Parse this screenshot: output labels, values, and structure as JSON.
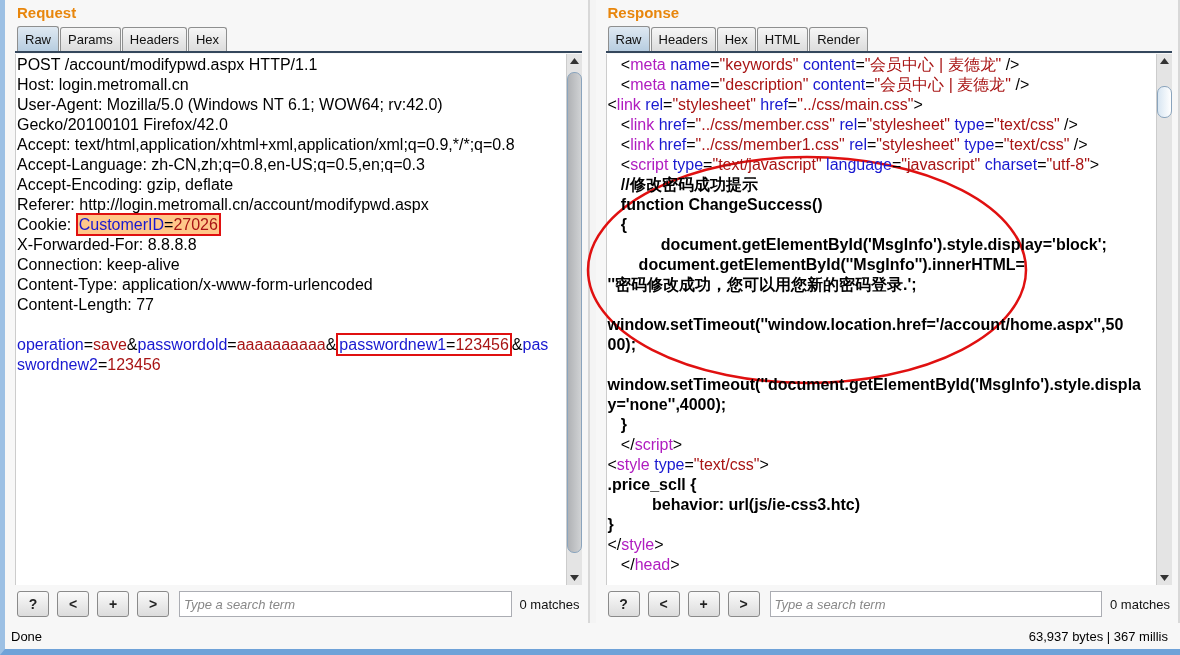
{
  "request": {
    "title": "Request",
    "tabs": [
      {
        "label": "Raw",
        "selected": true
      },
      {
        "label": "Params",
        "selected": false
      },
      {
        "label": "Headers",
        "selected": false
      },
      {
        "label": "Hex",
        "selected": false
      }
    ],
    "lines": [
      {
        "kind": "code",
        "segments": [
          {
            "kind": "text",
            "text": "POST /account/modifypwd.aspx HTTP/1.1"
          }
        ]
      },
      {
        "kind": "code",
        "segments": [
          {
            "kind": "text",
            "text": "Host: login.metromall.cn"
          }
        ]
      },
      {
        "kind": "code",
        "segments": [
          {
            "kind": "text",
            "text": "User-Agent: Mozilla/5.0 (Windows NT 6.1; WOW64; rv:42.0)"
          }
        ]
      },
      {
        "kind": "code",
        "segments": [
          {
            "kind": "text",
            "text": "Gecko/20100101 Firefox/42.0"
          }
        ]
      },
      {
        "kind": "code",
        "segments": [
          {
            "kind": "text",
            "text": "Accept: text/html,application/xhtml+xml,application/xml;q=0.9,*/*;q=0.8"
          }
        ]
      },
      {
        "kind": "code",
        "segments": [
          {
            "kind": "text",
            "text": "Accept-Language: zh-CN,zh;q=0.8,en-US;q=0.5,en;q=0.3"
          }
        ]
      },
      {
        "kind": "code",
        "segments": [
          {
            "kind": "text",
            "text": "Accept-Encoding: gzip, deflate"
          }
        ]
      },
      {
        "kind": "code",
        "segments": [
          {
            "kind": "text",
            "text": "Referer: http://login.metromall.cn/account/modifypwd.aspx"
          }
        ]
      },
      {
        "kind": "code",
        "segments": [
          {
            "kind": "text",
            "text": "Cookie: "
          },
          {
            "kind": "group",
            "boxed": true,
            "highlighted": true,
            "segments": [
              {
                "kind": "attr",
                "text": "CustomerID"
              },
              {
                "kind": "text",
                "text": "="
              },
              {
                "kind": "value",
                "text": "27026"
              }
            ]
          }
        ]
      },
      {
        "kind": "code",
        "segments": [
          {
            "kind": "text",
            "text": "X-Forwarded-For: 8.8.8.8"
          }
        ]
      },
      {
        "kind": "code",
        "segments": [
          {
            "kind": "text",
            "text": "Connection: keep-alive"
          }
        ]
      },
      {
        "kind": "code",
        "segments": [
          {
            "kind": "text",
            "text": "Content-Type: application/x-www-form-urlencoded"
          }
        ]
      },
      {
        "kind": "code",
        "segments": [
          {
            "kind": "text",
            "text": "Content-Length: 77"
          }
        ]
      },
      {
        "kind": "blank"
      },
      {
        "kind": "code",
        "segments": [
          {
            "kind": "attr",
            "text": "operation"
          },
          {
            "kind": "text",
            "text": "="
          },
          {
            "kind": "value",
            "text": "save"
          },
          {
            "kind": "text",
            "text": "&"
          },
          {
            "kind": "attr",
            "text": "passwordold"
          },
          {
            "kind": "text",
            "text": "="
          },
          {
            "kind": "value",
            "text": "aaaaaaaaaa"
          },
          {
            "kind": "text",
            "text": "&"
          },
          {
            "kind": "group",
            "boxed": true,
            "highlighted": false,
            "segments": [
              {
                "kind": "attr",
                "text": "passwordnew1"
              },
              {
                "kind": "text",
                "text": "="
              },
              {
                "kind": "value",
                "text": "123456"
              }
            ]
          },
          {
            "kind": "text",
            "text": "&"
          },
          {
            "kind": "attr",
            "text": "pas"
          }
        ]
      },
      {
        "kind": "code",
        "segments": [
          {
            "kind": "attr",
            "text": "swordnew2"
          },
          {
            "kind": "text",
            "text": "="
          },
          {
            "kind": "value",
            "text": "123456"
          }
        ]
      }
    ],
    "search": {
      "buttons": [
        "?",
        "<",
        "+",
        ">"
      ],
      "placeholder": "Type a search term",
      "matches": "0 matches"
    }
  },
  "response": {
    "title": "Response",
    "tabs": [
      {
        "label": "Raw",
        "selected": true
      },
      {
        "label": "Headers",
        "selected": false
      },
      {
        "label": "Hex",
        "selected": false
      },
      {
        "label": "HTML",
        "selected": false
      },
      {
        "label": "Render",
        "selected": false
      }
    ],
    "lines": [
      {
        "kind": "code",
        "segments": [
          {
            "kind": "text",
            "text": "   <"
          },
          {
            "kind": "tag",
            "text": "meta"
          },
          {
            "kind": "attr",
            "text": " name"
          },
          {
            "kind": "text",
            "text": "="
          },
          {
            "kind": "value",
            "text": "\"keywords\""
          },
          {
            "kind": "attr",
            "text": " content"
          },
          {
            "kind": "text",
            "text": "="
          },
          {
            "kind": "value",
            "text": "\"会员中心 | 麦德龙\""
          },
          {
            "kind": "text",
            "text": " />"
          }
        ]
      },
      {
        "kind": "code",
        "segments": [
          {
            "kind": "text",
            "text": "   <"
          },
          {
            "kind": "tag",
            "text": "meta"
          },
          {
            "kind": "attr",
            "text": " name"
          },
          {
            "kind": "text",
            "text": "="
          },
          {
            "kind": "value",
            "text": "\"description\""
          },
          {
            "kind": "attr",
            "text": " content"
          },
          {
            "kind": "text",
            "text": "="
          },
          {
            "kind": "value",
            "text": "\"会员中心 | 麦德龙\""
          },
          {
            "kind": "text",
            "text": " />"
          }
        ]
      },
      {
        "kind": "code",
        "segments": [
          {
            "kind": "text",
            "text": "<"
          },
          {
            "kind": "tag",
            "text": "link"
          },
          {
            "kind": "attr",
            "text": " rel"
          },
          {
            "kind": "text",
            "text": "="
          },
          {
            "kind": "value",
            "text": "\"stylesheet\""
          },
          {
            "kind": "attr",
            "text": " href"
          },
          {
            "kind": "text",
            "text": "="
          },
          {
            "kind": "value",
            "text": "\"../css/main.css\""
          },
          {
            "kind": "text",
            "text": ">"
          }
        ]
      },
      {
        "kind": "code",
        "segments": [
          {
            "kind": "text",
            "text": "   <"
          },
          {
            "kind": "tag",
            "text": "link"
          },
          {
            "kind": "attr",
            "text": " href"
          },
          {
            "kind": "text",
            "text": "="
          },
          {
            "kind": "value",
            "text": "\"../css/member.css\""
          },
          {
            "kind": "attr",
            "text": " rel"
          },
          {
            "kind": "text",
            "text": "="
          },
          {
            "kind": "value",
            "text": "\"stylesheet\""
          },
          {
            "kind": "attr",
            "text": " type"
          },
          {
            "kind": "text",
            "text": "="
          },
          {
            "kind": "value",
            "text": "\"text/css\""
          },
          {
            "kind": "text",
            "text": " />"
          }
        ]
      },
      {
        "kind": "code",
        "segments": [
          {
            "kind": "text",
            "text": "   <"
          },
          {
            "kind": "tag",
            "text": "link"
          },
          {
            "kind": "attr",
            "text": " href"
          },
          {
            "kind": "text",
            "text": "="
          },
          {
            "kind": "value",
            "text": "\"../css/member1.css\""
          },
          {
            "kind": "attr",
            "text": " rel"
          },
          {
            "kind": "text",
            "text": "="
          },
          {
            "kind": "value",
            "text": "\"stylesheet\""
          },
          {
            "kind": "attr",
            "text": " type"
          },
          {
            "kind": "text",
            "text": "="
          },
          {
            "kind": "value",
            "text": "\"text/css\""
          },
          {
            "kind": "text",
            "text": " />"
          }
        ]
      },
      {
        "kind": "code",
        "segments": [
          {
            "kind": "text",
            "text": "   <"
          },
          {
            "kind": "tag",
            "text": "script"
          },
          {
            "kind": "attr",
            "text": " type"
          },
          {
            "kind": "text",
            "text": "="
          },
          {
            "kind": "value",
            "text": "\"text/javascript\""
          },
          {
            "kind": "attr",
            "text": " language"
          },
          {
            "kind": "text",
            "text": "="
          },
          {
            "kind": "value",
            "text": "\"javascript\""
          },
          {
            "kind": "attr",
            "text": " charset"
          },
          {
            "kind": "text",
            "text": "="
          },
          {
            "kind": "value",
            "text": "\"utf-8\""
          },
          {
            "kind": "text",
            "text": ">"
          }
        ]
      },
      {
        "kind": "code",
        "segments": [
          {
            "kind": "code",
            "text": "   //修改密码成功提示"
          }
        ]
      },
      {
        "kind": "code",
        "segments": [
          {
            "kind": "code",
            "text": "   function ChangeSuccess()"
          }
        ]
      },
      {
        "kind": "code",
        "segments": [
          {
            "kind": "code",
            "text": "   {"
          }
        ]
      },
      {
        "kind": "code",
        "segments": [
          {
            "kind": "code",
            "text": "            document.getElementById('MsgInfo').style.display='block';"
          }
        ]
      },
      {
        "kind": "code",
        "segments": [
          {
            "kind": "code",
            "text": "       document.getElementById(''MsgInfo'').innerHTML="
          }
        ]
      },
      {
        "kind": "code",
        "segments": [
          {
            "kind": "code",
            "text": "''密码修改成功，您可以用您新的密码登录.';"
          }
        ]
      },
      {
        "kind": "blank"
      },
      {
        "kind": "code",
        "segments": [
          {
            "kind": "code",
            "text": "window.setTimeout(''window.location.href='/account/home.aspx'',50"
          }
        ]
      },
      {
        "kind": "code",
        "segments": [
          {
            "kind": "code",
            "text": "00);"
          }
        ]
      },
      {
        "kind": "blank"
      },
      {
        "kind": "code",
        "segments": [
          {
            "kind": "code",
            "text": "window.setTimeout(''document.getElementById('MsgInfo').style.displa"
          }
        ]
      },
      {
        "kind": "code",
        "segments": [
          {
            "kind": "code",
            "text": "y='none'',4000);"
          }
        ]
      },
      {
        "kind": "code",
        "segments": [
          {
            "kind": "code",
            "text": "   }"
          }
        ]
      },
      {
        "kind": "code",
        "segments": [
          {
            "kind": "text",
            "text": "   </"
          },
          {
            "kind": "tag",
            "text": "script"
          },
          {
            "kind": "text",
            "text": ">"
          }
        ]
      },
      {
        "kind": "code",
        "segments": [
          {
            "kind": "text",
            "text": "<"
          },
          {
            "kind": "tag",
            "text": "style"
          },
          {
            "kind": "attr",
            "text": " type"
          },
          {
            "kind": "text",
            "text": "="
          },
          {
            "kind": "value",
            "text": "\"text/css\""
          },
          {
            "kind": "text",
            "text": ">"
          }
        ]
      },
      {
        "kind": "code",
        "segments": [
          {
            "kind": "code",
            "text": ".price_scll {"
          }
        ]
      },
      {
        "kind": "code",
        "segments": [
          {
            "kind": "code",
            "text": "          behavior: url(js/ie-css3.htc)"
          }
        ]
      },
      {
        "kind": "code",
        "segments": [
          {
            "kind": "code",
            "text": "}"
          }
        ]
      },
      {
        "kind": "code",
        "segments": [
          {
            "kind": "text",
            "text": "</"
          },
          {
            "kind": "tag",
            "text": "style"
          },
          {
            "kind": "text",
            "text": ">"
          }
        ]
      },
      {
        "kind": "code",
        "segments": [
          {
            "kind": "text",
            "text": "   </"
          },
          {
            "kind": "tag",
            "text": "head"
          },
          {
            "kind": "text",
            "text": ">"
          }
        ]
      }
    ],
    "circled": true,
    "search": {
      "buttons": [
        "?",
        "<",
        "+",
        ">"
      ],
      "placeholder": "Type a search term",
      "matches": "0 matches"
    }
  },
  "status_bar": {
    "left": "Done",
    "right": "63,937 bytes | 367 millis"
  }
}
